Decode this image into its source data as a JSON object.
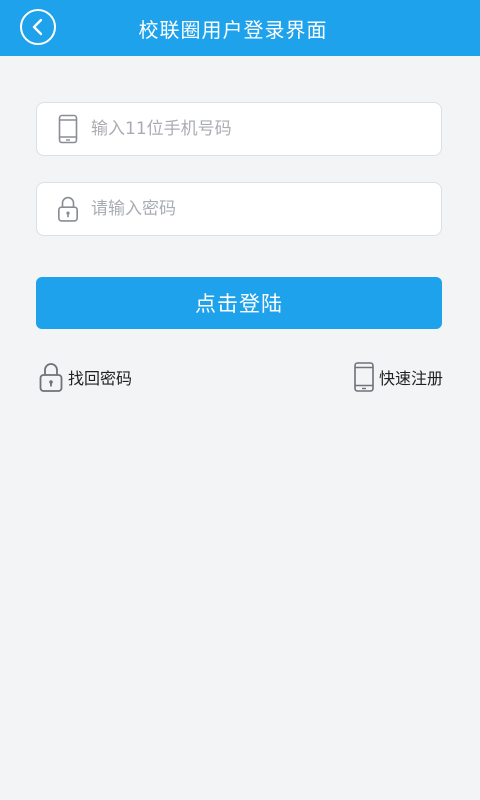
{
  "header": {
    "title": "校联圈用户登录界面",
    "back_icon": "back-circle-icon",
    "background": "#1ea2ec"
  },
  "form": {
    "phone": {
      "placeholder": "输入11位手机号码",
      "value": "",
      "icon": "phone-icon"
    },
    "password": {
      "placeholder": "请输入密码",
      "value": "",
      "icon": "lock-icon"
    },
    "login_label": "点击登陆"
  },
  "links": {
    "find_password": {
      "label": "找回密码",
      "icon": "lock-icon"
    },
    "quick_register": {
      "label": "快速注册",
      "icon": "phone-icon"
    }
  },
  "colors": {
    "accent": "#1ea2ec",
    "background": "#f3f4f6"
  }
}
